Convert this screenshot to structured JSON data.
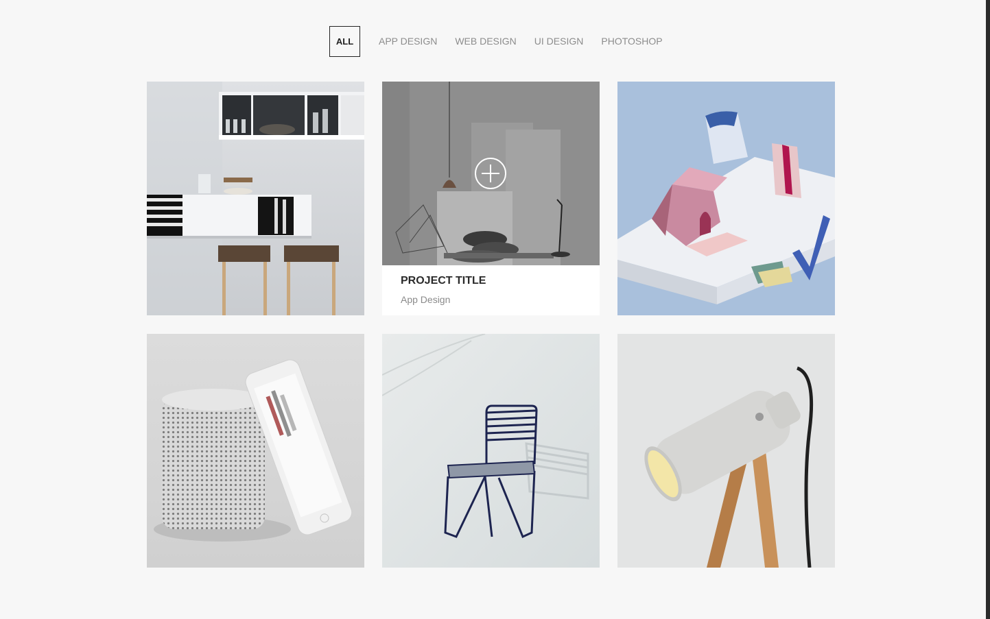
{
  "filters": [
    {
      "label": "ALL",
      "active": true
    },
    {
      "label": "APP DESIGN",
      "active": false
    },
    {
      "label": "WEB DESIGN",
      "active": false
    },
    {
      "label": "UI DESIGN",
      "active": false
    },
    {
      "label": "PHOTOSHOP",
      "active": false
    }
  ],
  "hovered_item": {
    "title": "PROJECT TITLE",
    "category": "App Design"
  },
  "colors": {
    "background": "#f7f7f7",
    "active_border": "#222222",
    "inactive_text": "#8c8c8c"
  }
}
